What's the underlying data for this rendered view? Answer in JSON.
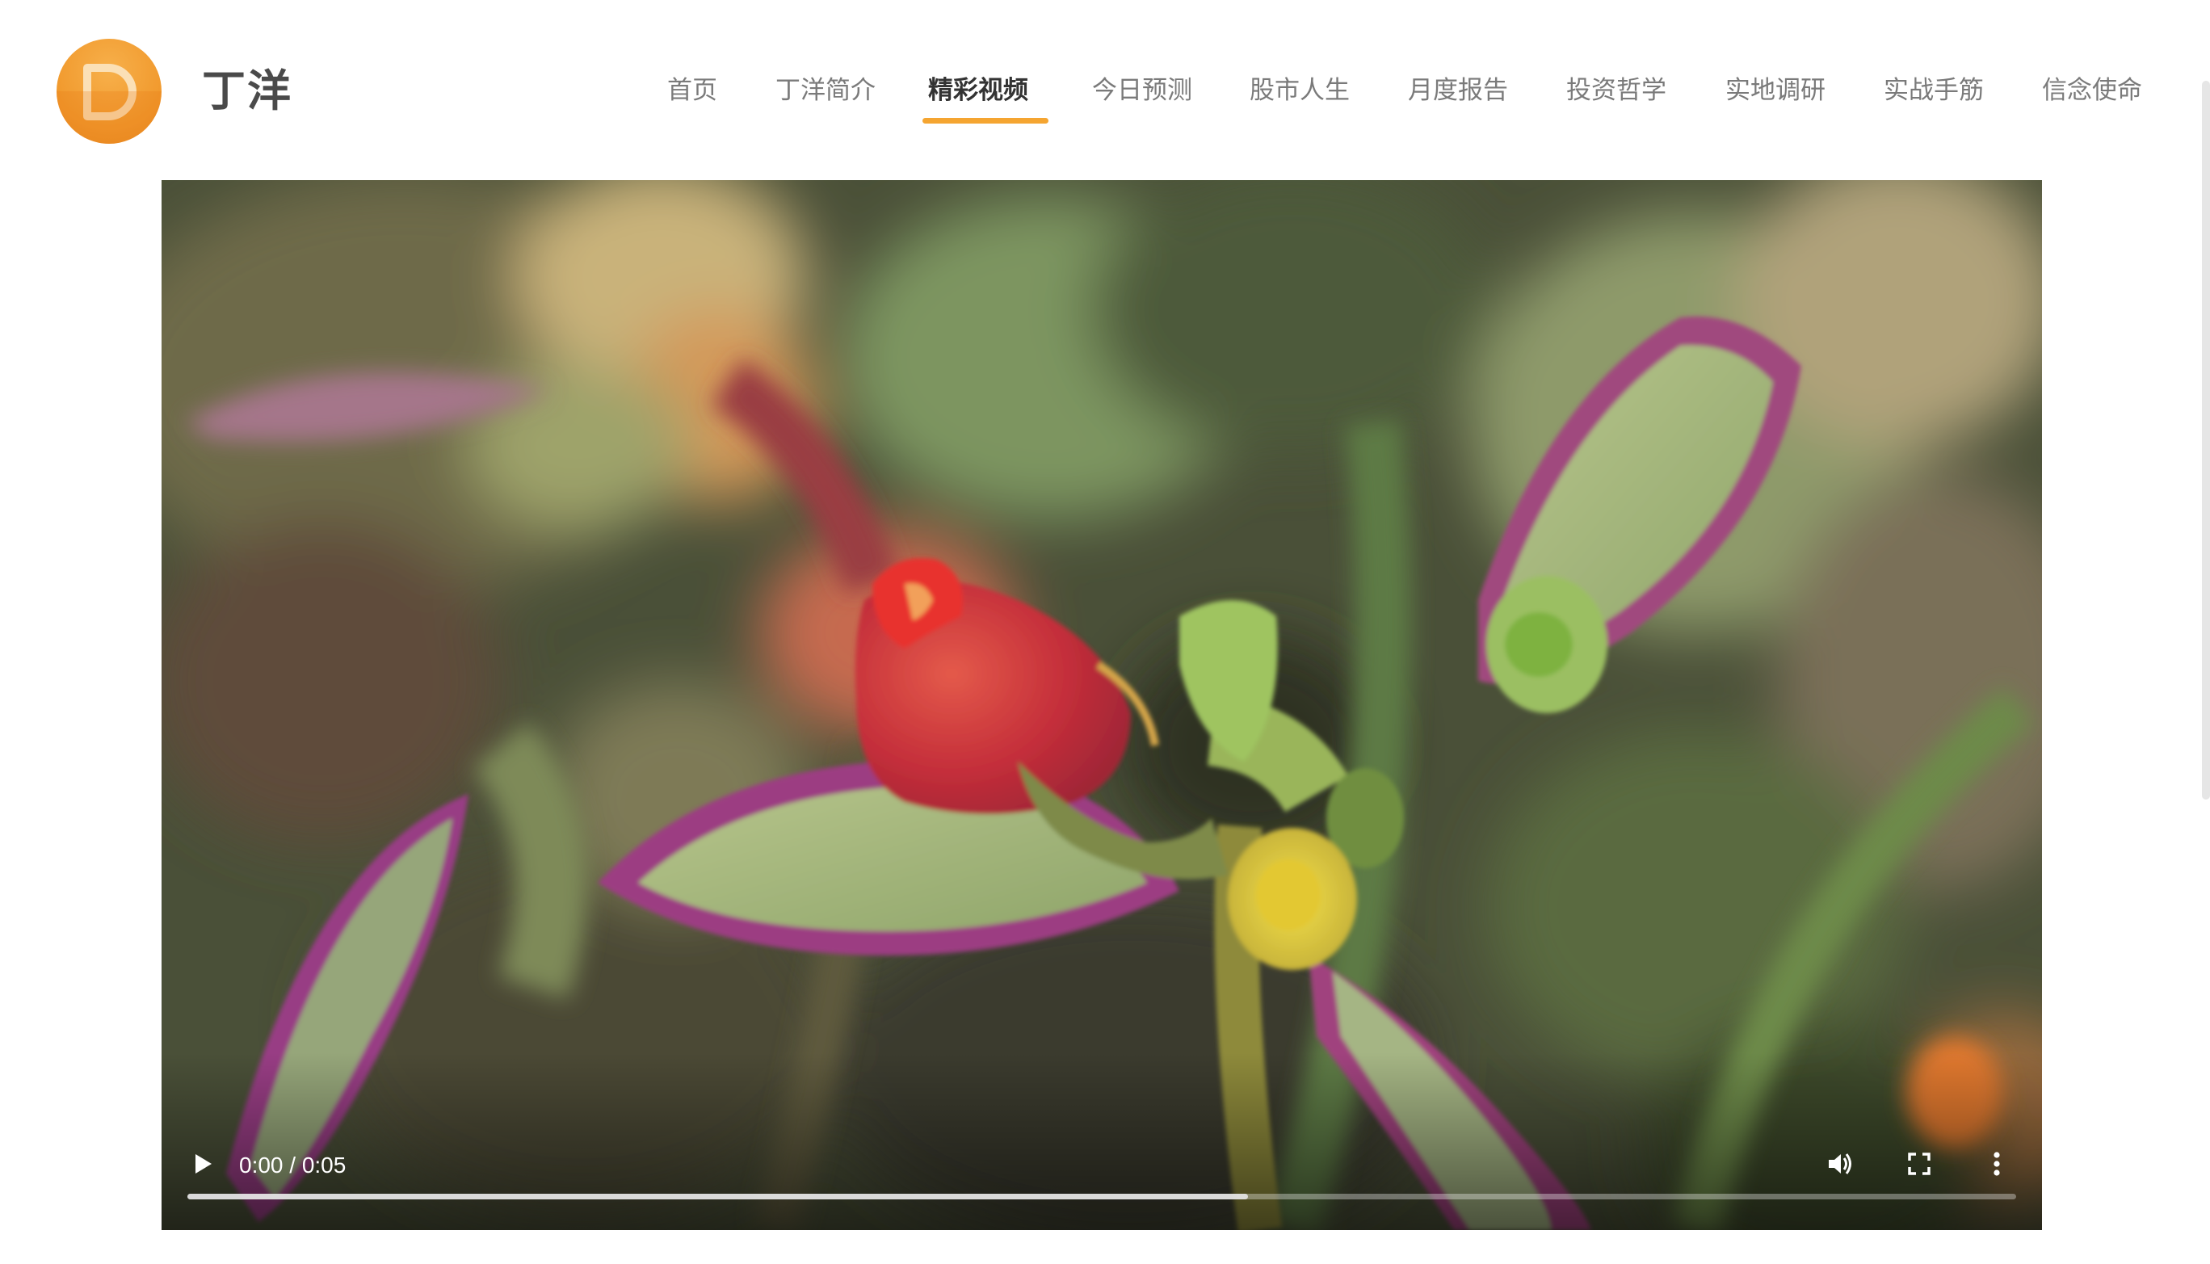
{
  "site": {
    "logo_icon": "d-letter-logo",
    "title": "丁洋"
  },
  "nav": {
    "items": [
      {
        "label": "首页",
        "active": false
      },
      {
        "label": "丁洋简介",
        "active": false
      },
      {
        "label": "精彩视频",
        "active": true
      },
      {
        "label": "今日预测",
        "active": false
      },
      {
        "label": "股市人生",
        "active": false
      },
      {
        "label": "月度报告",
        "active": false
      },
      {
        "label": "投资哲学",
        "active": false
      },
      {
        "label": "实地调研",
        "active": false
      },
      {
        "label": "实战手筋",
        "active": false
      },
      {
        "label": "信念使命",
        "active": false
      }
    ],
    "accent_color": "#f5a531"
  },
  "video": {
    "time_display": "0:00 / 0:05",
    "buffered_fraction": 0.58,
    "icons": {
      "play": "play-icon",
      "volume": "volume-icon",
      "fullscreen": "fullscreen-icon",
      "more": "more-vertical-icon"
    }
  }
}
